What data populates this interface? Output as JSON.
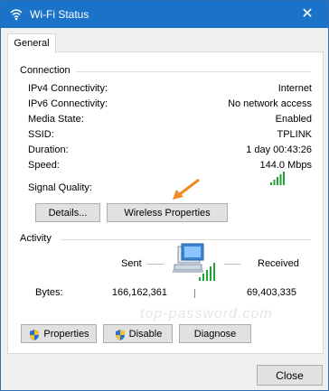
{
  "window": {
    "title": "Wi-Fi Status",
    "close_glyph": "✕"
  },
  "tabs": [
    {
      "label": "General"
    }
  ],
  "connection": {
    "heading": "Connection",
    "rows": [
      {
        "label": "IPv4 Connectivity:",
        "value": "Internet"
      },
      {
        "label": "IPv6 Connectivity:",
        "value": "No network access"
      },
      {
        "label": "Media State:",
        "value": "Enabled"
      },
      {
        "label": "SSID:",
        "value": "TPLINK"
      },
      {
        "label": "Duration:",
        "value": "1 day 00:43:26"
      },
      {
        "label": "Speed:",
        "value": "144.0 Mbps"
      }
    ],
    "signal_quality_label": "Signal Quality:",
    "signal_bars_filled": 5,
    "details_button": "Details...",
    "wireless_properties_button": "Wireless Properties"
  },
  "activity": {
    "heading": "Activity",
    "sent_label": "Sent",
    "received_label": "Received",
    "bytes_label": "Bytes:",
    "sent_bytes": "166,162,361",
    "received_bytes": "69,403,335"
  },
  "buttons": {
    "properties": "Properties",
    "disable": "Disable",
    "diagnose": "Diagnose",
    "close": "Close"
  },
  "watermark": "top-password.com",
  "colors": {
    "titlebar": "#1a73c9",
    "arrow": "#f08a24",
    "signal": "#22a336"
  }
}
